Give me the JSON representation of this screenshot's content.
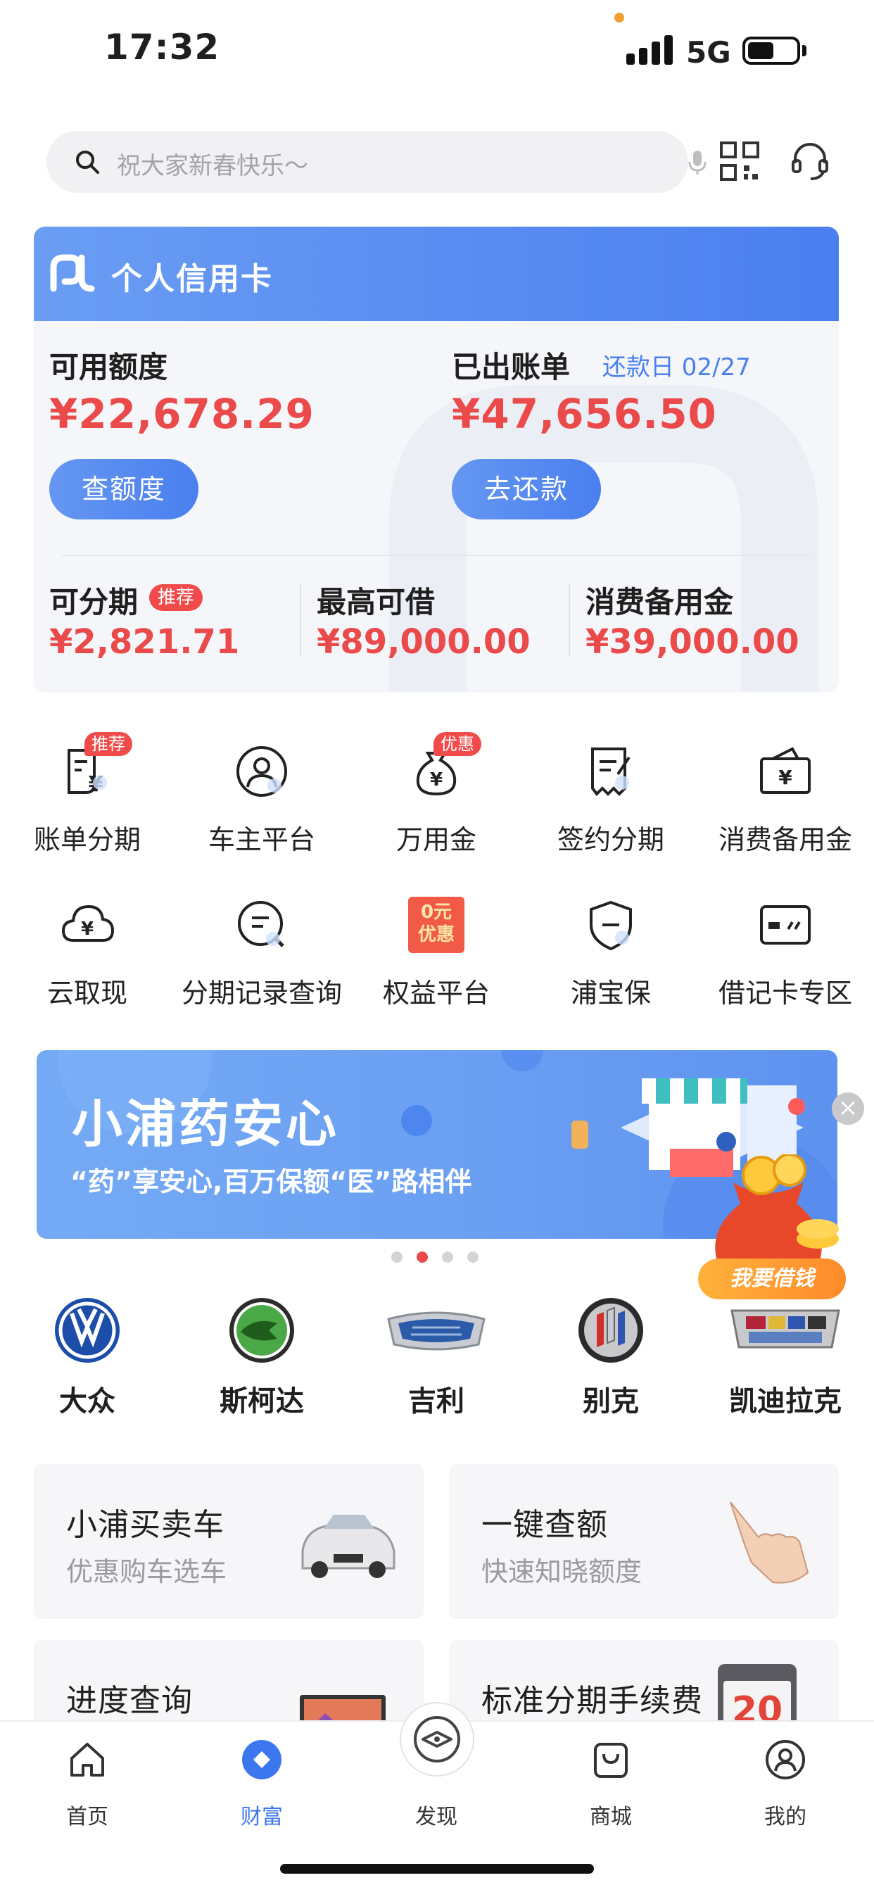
{
  "status": {
    "time": "17:32",
    "network": "5G"
  },
  "search": {
    "placeholder": "祝大家新春快乐～"
  },
  "card": {
    "title": "个人信用卡",
    "available_label": "可用额度",
    "available_amount": "¥22,678.29",
    "check_button": "查额度",
    "bill_label": "已出账单",
    "due_date": "还款日 02/27",
    "bill_amount": "¥47,656.50",
    "pay_button": "去还款",
    "installment_label": "可分期",
    "installment_badge": "推荐",
    "installment_amount": "¥2,821.71",
    "max_borrow_label": "最高可借",
    "max_borrow_amount": "¥89,000.00",
    "reserve_label": "消费备用金",
    "reserve_amount": "¥39,000.00"
  },
  "services": [
    {
      "label": "账单分期",
      "tag": "推荐",
      "icon": "bill-installment-icon"
    },
    {
      "label": "车主平台",
      "tag": "",
      "icon": "car-owner-icon"
    },
    {
      "label": "万用金",
      "tag": "优惠",
      "icon": "money-bag-icon"
    },
    {
      "label": "签约分期",
      "tag": "",
      "icon": "contract-icon"
    },
    {
      "label": "消费备用金",
      "tag": "",
      "icon": "wallet-icon"
    },
    {
      "label": "云取现",
      "tag": "",
      "icon": "cloud-cash-icon"
    },
    {
      "label": "分期记录查询",
      "tag": "",
      "icon": "record-search-icon"
    },
    {
      "label": "权益平台",
      "tag": "",
      "icon": "rights-coupon-icon"
    },
    {
      "label": "浦宝保",
      "tag": "",
      "icon": "shield-icon"
    },
    {
      "label": "借记卡专区",
      "tag": "",
      "icon": "debit-card-icon"
    }
  ],
  "coupon_icon_text": [
    "0元",
    "优惠"
  ],
  "banner": {
    "title": "小浦药安心",
    "subtitle": "“药”享安心,百万保额“医”路相伴",
    "dots_total": 4,
    "dots_active_index": 1
  },
  "loan_float": {
    "label": "我要借钱"
  },
  "brands": [
    {
      "name": "大众",
      "icon": "volkswagen-logo"
    },
    {
      "name": "斯柯达",
      "icon": "skoda-logo"
    },
    {
      "name": "吉利",
      "icon": "geely-logo"
    },
    {
      "name": "别克",
      "icon": "buick-logo"
    },
    {
      "name": "凯迪拉克",
      "icon": "cadillac-logo"
    }
  ],
  "tiles": [
    {
      "title": "小浦买卖车",
      "subtitle": "优惠购车选车",
      "icon": "car-image"
    },
    {
      "title": "一键查额",
      "subtitle": "快速知晓额度",
      "icon": "hand-pointer-image"
    },
    {
      "title": "进度查询",
      "subtitle": "",
      "icon": "laptop-image"
    },
    {
      "title": "标准分期手续费",
      "subtitle": "",
      "icon": "calendar-image"
    }
  ],
  "calendar_text": "20",
  "tabs": [
    {
      "label": "首页",
      "icon": "home-icon",
      "active": false
    },
    {
      "label": "财富",
      "icon": "wealth-icon",
      "active": true
    },
    {
      "label": "发现",
      "icon": "discover-icon",
      "active": false
    },
    {
      "label": "商城",
      "icon": "shop-bag-icon",
      "active": false
    },
    {
      "label": "我的",
      "icon": "profile-icon",
      "active": false
    }
  ],
  "colors": {
    "accent": "#4a7ff0",
    "amount_red": "#ea4a4a",
    "badge_red": "#f04a4a",
    "active_tab": "#3d77ef"
  }
}
